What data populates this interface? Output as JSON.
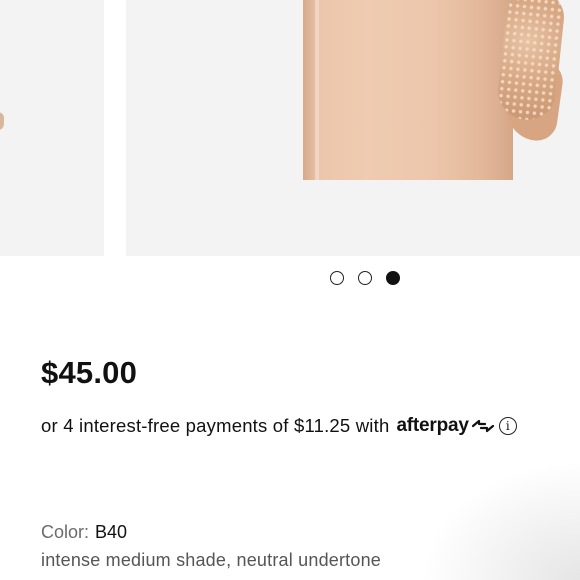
{
  "carousel": {
    "dot_count": 3,
    "active_index": 2,
    "product_color": "#e9c2a6"
  },
  "product": {
    "price": "$45.00"
  },
  "installments": {
    "text": "or 4 interest-free payments of $11.25 with",
    "provider": "afterpay",
    "info_icon": "info-icon"
  },
  "variant": {
    "color_label": "Color:",
    "color_value": "B40",
    "shade_description": "intense medium shade, neutral undertone"
  }
}
